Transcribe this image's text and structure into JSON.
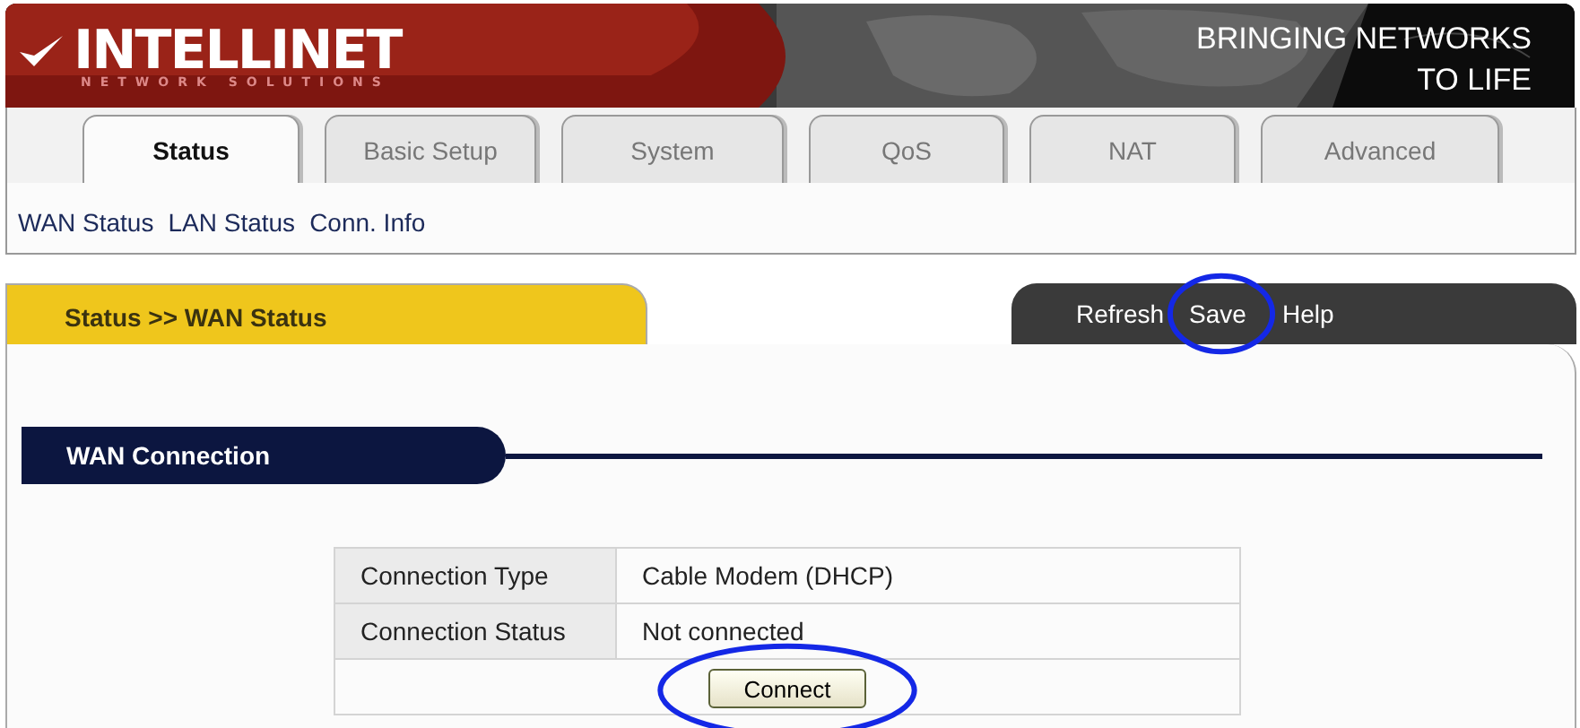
{
  "header": {
    "logo": "INTELLINET",
    "logo_subtitle": "NETWORK SOLUTIONS",
    "tagline": [
      "BRINGING NETWORKS",
      "TO LIFE"
    ]
  },
  "tabs": [
    {
      "label": "Status",
      "selected": true
    },
    {
      "label": "Basic Setup",
      "selected": false
    },
    {
      "label": "System",
      "selected": false
    },
    {
      "label": "QoS",
      "selected": false
    },
    {
      "label": "NAT",
      "selected": false
    },
    {
      "label": "Advanced",
      "selected": false
    }
  ],
  "submenu": [
    "WAN Status",
    "LAN Status",
    "Conn. Info"
  ],
  "breadcrumb": "Status >> WAN Status",
  "actions": [
    {
      "label": "Refresh",
      "circled": false
    },
    {
      "label": "Save",
      "circled": true
    },
    {
      "label": "Help",
      "circled": false
    }
  ],
  "section": {
    "title": "WAN Connection"
  },
  "table": {
    "rows": [
      {
        "label": "Connection Type",
        "value": "Cable Modem (DHCP)"
      },
      {
        "label": "Connection Status",
        "value": "Not connected"
      }
    ],
    "button": {
      "label": "Connect",
      "circled": true
    }
  }
}
